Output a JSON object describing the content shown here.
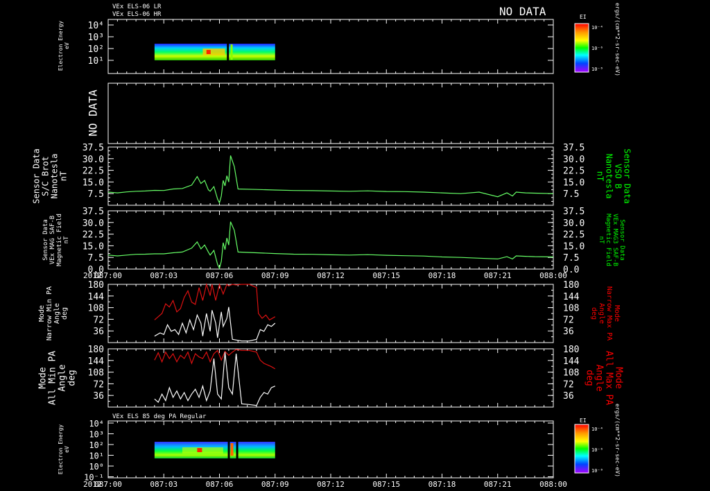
{
  "header": {
    "line1": "VEx ELS-06 LR",
    "line2": "VEx ELS-06 HR",
    "no_data": "NO DATA"
  },
  "bottom_header": "VEx ELS 85 deg PA Regular",
  "colorbar": {
    "label": "EI",
    "ticks": [
      "10⁻⁴",
      "10⁻⁶",
      "10⁻⁸"
    ],
    "units": "ergs/(cm**2-sr-sec-eV)"
  },
  "x_axis": {
    "year": "2012",
    "ticks": [
      "087:00",
      "087:03",
      "087:06",
      "087:09",
      "087:12",
      "087:15",
      "087:18",
      "087:21",
      "088:00"
    ]
  },
  "colors": {
    "frame": "#ffffff",
    "green": "#00ff00",
    "red": "#ff0000",
    "trace_green": "#66ff66",
    "trace_red": "#dd1111"
  },
  "chart_data": [
    {
      "type": "heatmap",
      "panel": "spectrogram-top",
      "ylabel": [
        "Electron Energy",
        "eV"
      ],
      "yticks": [
        "10⁴",
        "10³",
        "10²",
        "10¹"
      ],
      "data_extent": [
        "087:03",
        "087:09"
      ]
    },
    {
      "type": "line",
      "panel": "no-data",
      "ylabel": [
        "NO DATA"
      ],
      "series": []
    },
    {
      "type": "line",
      "panel": "mag-brot",
      "ylabel": [
        "Sensor Data",
        "S/C Brot",
        "Nanotesla",
        "nT"
      ],
      "ylabel_right": [
        "Sensor Data",
        "VSO B",
        "Nanotesla",
        "nT"
      ],
      "yticks": [
        "37.5",
        "30.0",
        "22.5",
        "15.0",
        "7.5"
      ],
      "ylim": [
        0,
        37.5
      ],
      "series": [
        {
          "x": [
            0,
            0.5,
            1.0,
            1.5,
            2.0,
            2.5,
            3.0,
            3.5,
            4.0,
            4.5,
            4.8,
            5.0,
            5.2,
            5.4,
            5.5,
            5.7,
            5.9,
            6.0,
            6.1,
            6.2,
            6.3,
            6.4,
            6.5,
            6.6,
            6.8,
            7.0,
            8.0,
            9.0,
            10.0,
            11.0,
            12.0,
            13.0,
            14.0,
            15.0,
            16.0,
            17.0,
            18.0,
            19.0,
            20.0,
            21.0,
            21.5,
            21.8,
            22.0,
            22.5,
            23.0,
            24.0
          ],
          "y": [
            8.5,
            8.0,
            8.6,
            9.0,
            9.2,
            9.6,
            9.5,
            10.5,
            10.8,
            13.0,
            18.5,
            14.0,
            16.0,
            10.0,
            9.0,
            12.0,
            4.0,
            1.5,
            6.0,
            16.0,
            12.5,
            19.0,
            15.0,
            32.0,
            25.0,
            10.5,
            10.2,
            9.8,
            9.5,
            9.4,
            9.2,
            9.0,
            9.3,
            8.9,
            8.8,
            8.5,
            8.0,
            7.5,
            8.5,
            5.5,
            8.0,
            6.0,
            8.5,
            8.0,
            7.8,
            7.5
          ]
        }
      ]
    },
    {
      "type": "line",
      "panel": "mag-saf",
      "ylabel": [
        "Sensor Data",
        "VEx MAG SAF-B",
        "Magnetic Field",
        "nT"
      ],
      "ylabel_right": [
        "Sensor Data",
        "VEx MAG3 SAF-B",
        "Magnetic Field",
        "nT"
      ],
      "yticks": [
        "37.5",
        "30.0",
        "22.5",
        "15.0",
        "7.5",
        "0.0"
      ],
      "ylim": [
        0,
        37.5
      ],
      "series": [
        {
          "x": [
            0,
            0.5,
            1.0,
            1.5,
            2.0,
            2.5,
            3.0,
            3.5,
            4.0,
            4.5,
            4.8,
            5.0,
            5.2,
            5.4,
            5.5,
            5.7,
            5.9,
            6.0,
            6.1,
            6.2,
            6.3,
            6.4,
            6.5,
            6.6,
            6.8,
            7.0,
            8.0,
            9.0,
            10.0,
            11.0,
            12.0,
            13.0,
            14.0,
            15.0,
            16.0,
            17.0,
            18.0,
            19.0,
            20.0,
            21.0,
            21.5,
            21.8,
            22.0,
            22.5,
            23.0,
            24.0
          ],
          "y": [
            9.0,
            8.5,
            9.0,
            9.5,
            9.6,
            9.8,
            9.8,
            10.5,
            11.0,
            13.5,
            17.5,
            13.0,
            15.5,
            11.0,
            9.0,
            12.0,
            3.0,
            0.5,
            5.0,
            17.0,
            12.5,
            20.0,
            15.5,
            30.5,
            25.0,
            11.0,
            10.5,
            10.0,
            9.6,
            9.5,
            9.2,
            9.0,
            9.3,
            8.9,
            8.6,
            8.4,
            7.8,
            7.5,
            7.0,
            6.5,
            8.0,
            6.5,
            8.5,
            8.2,
            8.0,
            7.8
          ]
        }
      ]
    },
    {
      "type": "line",
      "panel": "pa-narrow",
      "ylabel": [
        "Mode",
        "Narrow Min PA",
        "Angle",
        "deg"
      ],
      "ylabel_right": [
        "Mode",
        "Narrow Max PA",
        "Angle",
        "deg"
      ],
      "yticks": [
        "180",
        "144",
        "108",
        "72",
        "36"
      ],
      "ylim": [
        0,
        180
      ],
      "series": [
        {
          "name": "Narrow Min PA",
          "color": "white",
          "x": [
            2.5,
            2.8,
            3.0,
            3.2,
            3.4,
            3.6,
            3.8,
            4.0,
            4.2,
            4.4,
            4.6,
            4.8,
            5.0,
            5.1,
            5.3,
            5.5,
            5.6,
            5.8,
            5.9,
            6.1,
            6.2,
            6.4,
            6.5,
            6.7,
            6.9,
            7.2,
            7.6,
            8.0,
            8.2,
            8.4,
            8.6,
            8.8,
            9.0
          ],
          "y": [
            20,
            30,
            25,
            55,
            35,
            40,
            25,
            60,
            30,
            70,
            40,
            85,
            60,
            20,
            90,
            35,
            100,
            60,
            15,
            95,
            50,
            75,
            110,
            10,
            8,
            5,
            5,
            10,
            40,
            35,
            55,
            50,
            60
          ]
        },
        {
          "name": "Narrow Max PA",
          "color": "red",
          "x": [
            2.5,
            2.7,
            2.9,
            3.1,
            3.3,
            3.5,
            3.7,
            3.9,
            4.1,
            4.3,
            4.5,
            4.7,
            4.9,
            5.1,
            5.3,
            5.5,
            5.6,
            5.8,
            6.0,
            6.2,
            6.4,
            6.5,
            6.7,
            6.9,
            7.2,
            7.6,
            8.0,
            8.1,
            8.3,
            8.5,
            8.7,
            9.0
          ],
          "y": [
            70,
            80,
            90,
            120,
            110,
            130,
            95,
            105,
            140,
            160,
            125,
            118,
            170,
            130,
            180,
            145,
            180,
            130,
            180,
            150,
            180,
            175,
            180,
            178,
            180,
            180,
            170,
            90,
            75,
            85,
            70,
            80
          ]
        }
      ]
    },
    {
      "type": "line",
      "panel": "pa-all",
      "ylabel": [
        "Mode",
        "All Min PA",
        "Angle",
        "deg"
      ],
      "ylabel_right": [
        "Mode",
        "All Max PA",
        "Angle",
        "deg"
      ],
      "yticks": [
        "180",
        "144",
        "108",
        "72",
        "36"
      ],
      "ylim": [
        0,
        180
      ],
      "series": [
        {
          "name": "All Min PA",
          "color": "white",
          "x": [
            2.5,
            2.7,
            2.9,
            3.1,
            3.3,
            3.5,
            3.7,
            3.9,
            4.1,
            4.3,
            4.5,
            4.7,
            4.9,
            5.1,
            5.3,
            5.5,
            5.7,
            5.9,
            6.1,
            6.3,
            6.5,
            6.7,
            6.9,
            7.2,
            7.6,
            8.0,
            8.2,
            8.4,
            8.6,
            8.8,
            9.0
          ],
          "y": [
            25,
            15,
            40,
            20,
            60,
            30,
            50,
            25,
            45,
            20,
            40,
            55,
            30,
            65,
            20,
            50,
            150,
            40,
            25,
            170,
            60,
            40,
            165,
            10,
            8,
            5,
            30,
            45,
            40,
            60,
            65
          ]
        },
        {
          "name": "All Max PA",
          "color": "red",
          "x": [
            2.5,
            2.7,
            2.9,
            3.1,
            3.3,
            3.5,
            3.7,
            3.9,
            4.1,
            4.3,
            4.5,
            4.7,
            4.9,
            5.1,
            5.3,
            5.5,
            5.7,
            5.9,
            6.1,
            6.3,
            6.5,
            6.7,
            6.9,
            7.2,
            7.6,
            8.0,
            8.2,
            8.4,
            8.6,
            8.8,
            9.0
          ],
          "y": [
            145,
            168,
            140,
            170,
            150,
            165,
            140,
            160,
            150,
            170,
            135,
            165,
            155,
            150,
            170,
            140,
            165,
            175,
            145,
            172,
            160,
            170,
            178,
            175,
            175,
            170,
            145,
            135,
            130,
            125,
            118
          ]
        }
      ]
    },
    {
      "type": "heatmap",
      "panel": "spectrogram-bottom",
      "ylabel": [
        "Electron Energy",
        "eV"
      ],
      "yticks": [
        "10⁴",
        "10³",
        "10²",
        "10¹",
        "10⁰",
        "10⁻¹"
      ],
      "data_extent": [
        "087:03",
        "087:09"
      ]
    }
  ]
}
